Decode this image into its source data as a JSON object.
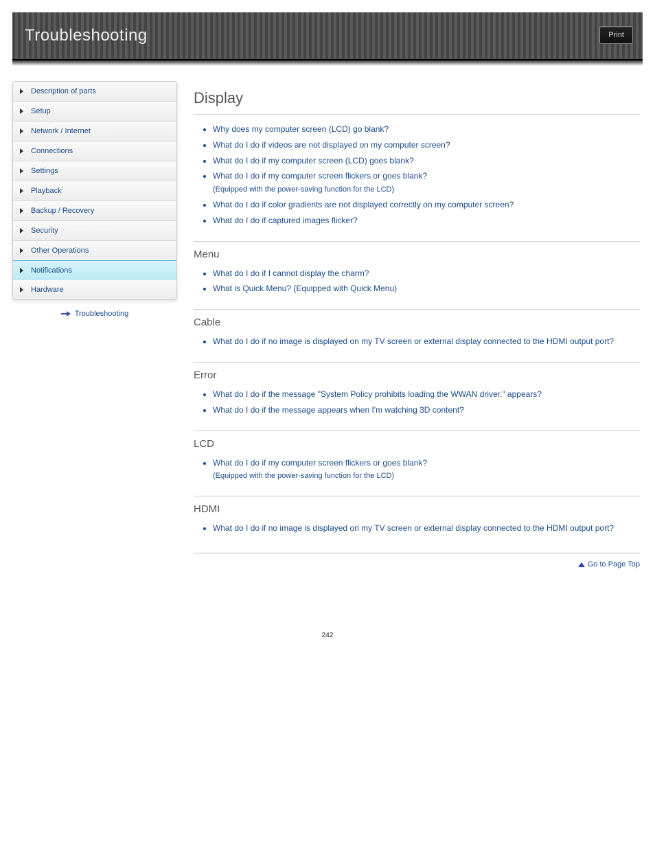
{
  "header": {
    "title": "Troubleshooting",
    "print_label": "Print"
  },
  "sidebar": {
    "items": [
      {
        "label": "Description of parts"
      },
      {
        "label": "Setup"
      },
      {
        "label": "Network / Internet"
      },
      {
        "label": "Connections"
      },
      {
        "label": "Settings"
      },
      {
        "label": "Playback"
      },
      {
        "label": "Backup / Recovery"
      },
      {
        "label": "Security"
      },
      {
        "label": "Other Operations"
      },
      {
        "label": "Notifications"
      },
      {
        "label": "Hardware"
      }
    ],
    "active_index": 9,
    "footer_link": "Troubleshooting"
  },
  "content": {
    "title": "Display",
    "sections": [
      {
        "title": "",
        "items": [
          "Why does my computer screen (LCD) go blank?",
          "What do I do if videos are not displayed on my computer screen?",
          "What do I do if my computer screen (LCD) goes blank?",
          {
            "text": "What do I do if my computer screen flickers or goes blank?",
            "sub": "(Equipped with the power-saving function for the LCD)"
          },
          "What do I do if color gradients are not displayed correctly on my computer screen?",
          "What do I do if captured images flicker?"
        ]
      },
      {
        "title": "Menu",
        "items": [
          "What do I do if I cannot display the charm?",
          "What is Quick Menu? (Equipped with Quick Menu)"
        ]
      },
      {
        "title": "Cable",
        "items": [
          "What do I do if no image is displayed on my TV screen or external display connected to the HDMI output port?"
        ]
      },
      {
        "title": "Error",
        "items": [
          "What do I do if the message \"System Policy prohibits loading the WWAN driver.\" appears?",
          "What do I do if the message appears when I'm watching 3D content?"
        ]
      },
      {
        "title": "LCD",
        "items": [
          {
            "text": "What do I do if my computer screen flickers or goes blank?",
            "sub": "(Equipped with the power-saving function for the LCD)"
          }
        ]
      },
      {
        "title": "HDMI",
        "items": [
          "What do I do if no image is displayed on my TV screen or external display connected to the HDMI output port?"
        ]
      }
    ]
  },
  "footer": {
    "to_top": "Go to Page Top"
  },
  "page_number": "242"
}
